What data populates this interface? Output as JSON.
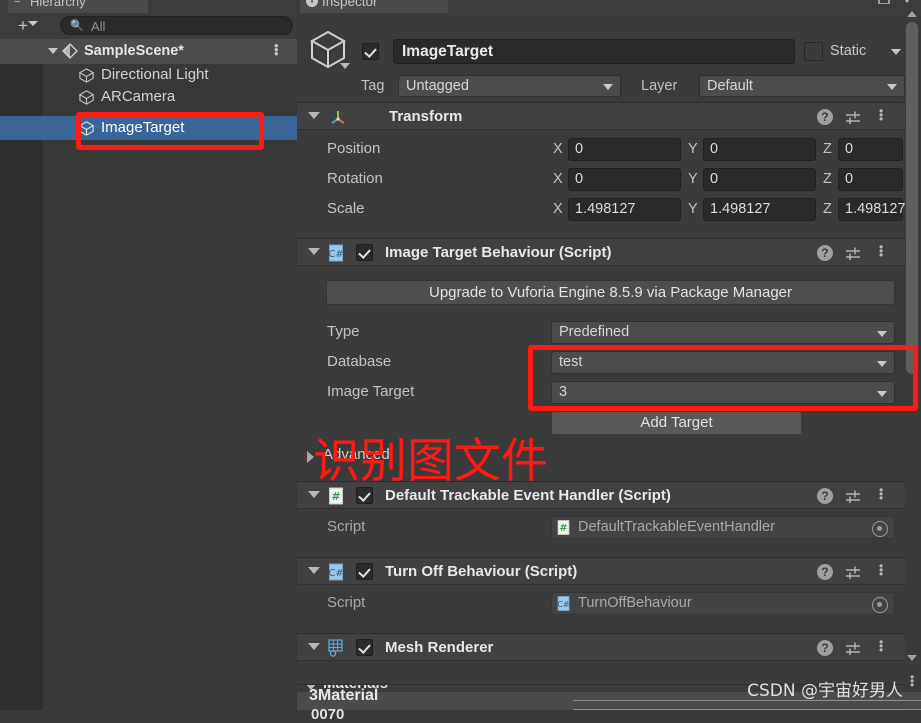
{
  "hierarchy": {
    "tab_label": "Hierarchy",
    "tab_icon": "hierarchy-icon",
    "add_button": "+",
    "search": {
      "placeholder": "All",
      "value": "",
      "icon": "search-icon"
    },
    "scene": {
      "label": "SampleScene*",
      "icon": "unity-scene-icon",
      "menu": "⋮"
    },
    "items": [
      {
        "label": "Directional Light",
        "icon": "gameobject-cube-icon",
        "selected": false
      },
      {
        "label": "ARCamera",
        "icon": "gameobject-cube-icon",
        "selected": false
      },
      {
        "label": "ImageTarget",
        "icon": "gameobject-cube-icon",
        "selected": true
      }
    ]
  },
  "inspector": {
    "tab_label": "Inspector",
    "tab_icon": "info-icon",
    "lock_icon": "lock-icon",
    "menu_icon": "⋮",
    "header": {
      "enabled": true,
      "name": "ImageTarget",
      "prefab_icon": "prefab-cube-icon",
      "static_label": "Static",
      "static_checked": false,
      "tag_label": "Tag",
      "tag_value": "Untagged",
      "layer_label": "Layer",
      "layer_value": "Default"
    },
    "transform": {
      "title": "Transform",
      "icon": "transform-axis-icon",
      "expanded": true,
      "rows": [
        {
          "label": "Position",
          "x": "0",
          "y": "0",
          "z": "0"
        },
        {
          "label": "Rotation",
          "x": "0",
          "y": "0",
          "z": "0"
        },
        {
          "label": "Scale",
          "x": "1.498127",
          "y": "1.498127",
          "z": "1.498127"
        }
      ],
      "axis_labels": {
        "x": "X",
        "y": "Y",
        "z": "Z"
      }
    },
    "image_target_behaviour": {
      "title": "Image Target Behaviour (Script)",
      "icon": "csharp-script-icon",
      "enabled": true,
      "expanded": true,
      "upgrade_button": "Upgrade to Vuforia Engine 8.5.9 via Package Manager",
      "type_label": "Type",
      "type_value": "Predefined",
      "database_label": "Database",
      "database_value": "test",
      "image_target_label": "Image Target",
      "image_target_value": "3",
      "add_target_button": "Add Target",
      "advanced_label": "Advanced",
      "advanced_expanded": false
    },
    "default_trackable_event_handler": {
      "title": "Default Trackable Event Handler (Script)",
      "icon": "csharp-script-icon",
      "enabled": true,
      "expanded": true,
      "script_label": "Script",
      "script_value": "DefaultTrackableEventHandler"
    },
    "turn_off_behaviour": {
      "title": "Turn Off Behaviour (Script)",
      "icon": "csharp-script-icon",
      "enabled": true,
      "expanded": true,
      "script_label": "Script",
      "script_value": "TurnOffBehaviour"
    },
    "mesh_renderer": {
      "title": "Mesh Renderer",
      "icon": "mesh-renderer-icon",
      "enabled": true,
      "expanded": true,
      "materials_label": "Materials"
    },
    "header_icons": {
      "help": "help-icon",
      "preset": "preset-icon",
      "menu": "kebab-menu-icon"
    }
  },
  "overlay": {
    "material_label": "3Material",
    "material_sub": "0070"
  },
  "annotations": {
    "chinese_note": "识别图文件",
    "color": "#ff1a13",
    "boxes": [
      "hierarchy-imagetarget-box",
      "database-imagetarget-box"
    ]
  },
  "watermark": {
    "text": "CSDN @宇宙好男人"
  }
}
